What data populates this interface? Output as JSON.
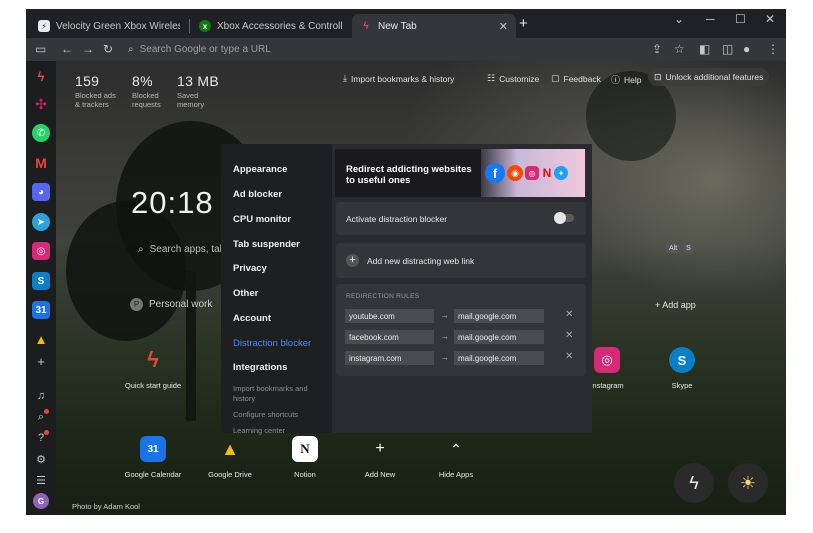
{
  "tabs": [
    {
      "title": "Velocity Green Xbox Wireless Contro",
      "favicon": "lightning-icon"
    },
    {
      "title": "Xbox Accessories & Controllers | Xbo",
      "favicon": "xbox-icon"
    },
    {
      "title": "New Tab",
      "favicon": "tab-lightning-icon"
    }
  ],
  "new_tab_symbol": "+",
  "omnibox": {
    "placeholder": "Search Google or type a URL"
  },
  "stats": [
    {
      "value": "159",
      "label": "Blocked ads & trackers"
    },
    {
      "value": "8%",
      "label": "Blocked requests"
    },
    {
      "value": "13 MB",
      "label": "Saved memory"
    }
  ],
  "toplinks": {
    "import": "Import bookmarks & history",
    "customize": "Customize",
    "feedback": "Feedback",
    "help": "Help",
    "unlock": "Unlock additional features"
  },
  "clock": "20:18",
  "search_placeholder": "Search apps, tabs...",
  "personal_label": "Personal work",
  "alt_badge": [
    "Alt",
    "S"
  ],
  "add_app": "+ Add app",
  "settings": {
    "nav": [
      "Appearance",
      "Ad blocker",
      "CPU monitor",
      "Tab suspender",
      "Privacy",
      "Other",
      "Account",
      "Distraction blocker",
      "Integrations"
    ],
    "sub": [
      "Import bookmarks and history",
      "Configure shortcuts",
      "Learning center"
    ],
    "banner_title": "Redirect addicting websites to useful ones",
    "activate_label": "Activate distraction blocker",
    "add_link_label": "Add new distracting web link",
    "rules_title": "REDIRECTION RULES",
    "rules": [
      {
        "from": "youtube.com",
        "to": "mail.google.com"
      },
      {
        "from": "facebook.com",
        "to": "mail.google.com"
      },
      {
        "from": "instagram.com",
        "to": "mail.google.com"
      }
    ]
  },
  "apps": {
    "quick_start": "Quick start guide",
    "instagram": "Instagram",
    "skype": "Skype",
    "google_calendar": "Google Calendar",
    "google_drive": "Google Drive",
    "notion": "Notion",
    "add_new": "Add New",
    "hide_apps": "Hide Apps"
  },
  "photo_credit": "Photo by Adam Kool",
  "colors": {
    "accent": "#4a8cf7",
    "panel_bg": "#2a2b2e",
    "nav_bg": "#1e1f21"
  }
}
